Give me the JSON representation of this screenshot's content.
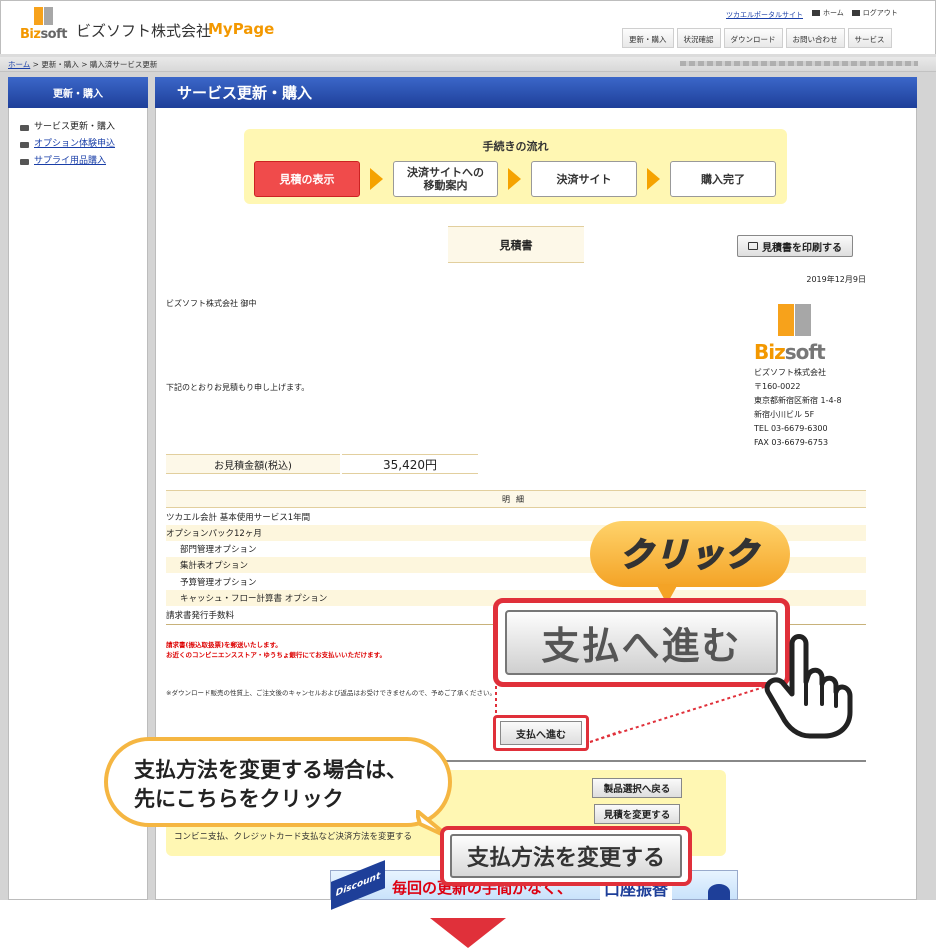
{
  "header": {
    "logo_text_biz": "Biz",
    "logo_text_soft": "soft",
    "company": "ビズソフト株式会社",
    "mypage": "MyPage",
    "portal_link": "ツカエルポータルサイト",
    "home_label": "ホーム",
    "logout_label": "ログアウト",
    "nav": [
      "更新・購入",
      "状況確認",
      "ダウンロード",
      "お問い合わせ",
      "サービス"
    ]
  },
  "breadcrumb": {
    "home": "ホーム",
    "sep1": " > ",
    "item1": "更新・購入",
    "sep2": " > ",
    "item2": "購入済サービス更新"
  },
  "sidebar": {
    "title": "更新・購入",
    "items": [
      {
        "label": "サービス更新・購入",
        "link": false
      },
      {
        "label": "オプション体験申込",
        "link": true
      },
      {
        "label": "サプライ用品購入",
        "link": true
      }
    ]
  },
  "main": {
    "title": "サービス更新・購入",
    "flow": {
      "title": "手続きの流れ",
      "steps": [
        "見積の表示",
        "決済サイトへの\n移動案内",
        "決済サイト",
        "購入完了"
      ]
    },
    "quote_title": "見積書",
    "print_button": "見積書を印刷する",
    "date": "2019年12月9日",
    "addressee": "ビズソフト株式会社 御中",
    "intro": "下記のとおりお見積もり申し上げます。",
    "company_block": {
      "logo_biz": "Biz",
      "logo_soft": "soft",
      "lines": [
        "ビズソフト株式会社",
        "〒160-0022",
        "東京都新宿区新宿 1-4-8",
        "新宿小川ビル 5F",
        "TEL 03-6679-6300",
        "FAX 03-6679-6753"
      ]
    },
    "amount_label": "お見積金額(税込)",
    "amount_value": "35,420円",
    "detail_head": "明細",
    "details": [
      "ツカエル会計 基本使用サービス1年間",
      "オプションパック12ヶ月",
      "部門管理オプション",
      "集計表オプション",
      "予算管理オプション",
      "キャッシュ・フロー計算書 オプション",
      "請求書発行手数料"
    ],
    "red_note_1": "請求書(振込取扱票)を郵送いたします。",
    "red_note_2": "お近くのコンビニエンスストア・ゆうちょ銀行にてお支払いいただけます。",
    "small_note": "※ダウンロード販売の性質上、ご注文後のキャンセルおよび返品はお受けできませんので、予めご了承ください。",
    "pay_button": "支払へ進む",
    "product_button": "製品選択へ戻る",
    "estimate_button": "見積を変更する",
    "conv_text": "コンビニ支払、クレジットカード支払など決済方法を変更する",
    "banner_tag": "Discount",
    "banner_text": "毎回の更新の手間がなく、",
    "banner_text2": "口座振替"
  },
  "callouts": {
    "click": "クリック",
    "big_pay": "支払へ進む",
    "change_line1": "支払方法を変更する場合は、",
    "change_line2": "先にこちらをクリック",
    "big_change": "支払方法を変更する"
  },
  "colors": {
    "accent": "#e0303a",
    "brand_orange": "#f39800",
    "header_blue": "#1e3f99",
    "flow_yellow": "#fff7b3"
  }
}
